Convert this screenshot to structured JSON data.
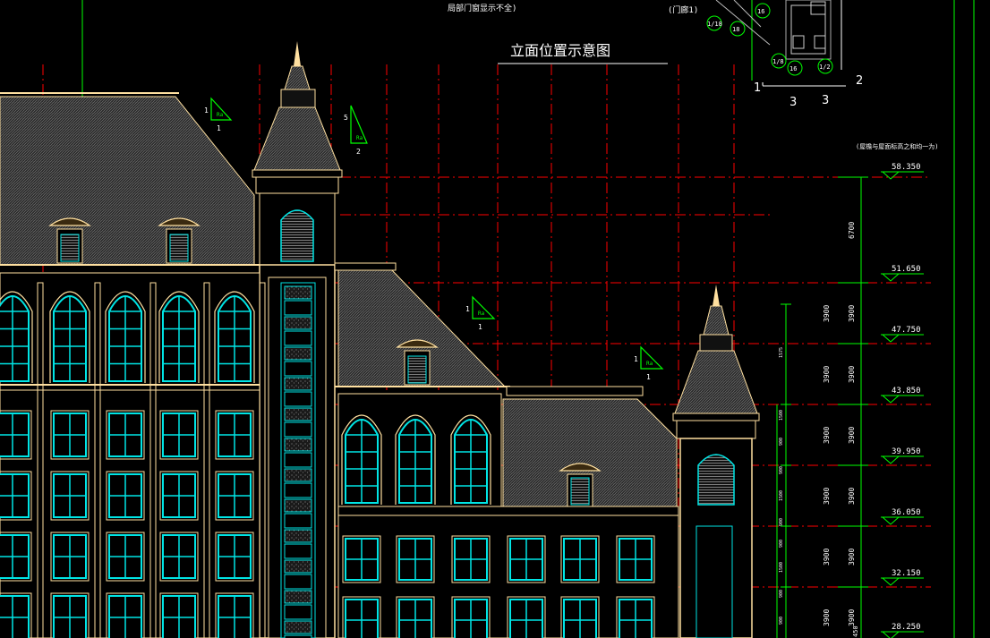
{
  "colors": {
    "background": "#000000",
    "gridline_red": "#ff0000",
    "dimension_green": "#00ff00",
    "building_outline": "#ffe0a0",
    "window_glass": "#00e5e5",
    "roof_texture": "#909090",
    "annotation_white": "#ffffff"
  },
  "header": {
    "top_note": "局部门窗显示不全)",
    "top_note_right": "(门廊1)",
    "title": "立面位置示意图"
  },
  "axis_markers": {
    "left_1": "1'",
    "right_2": "2",
    "bottom_3a": "3",
    "bottom_3b": "3",
    "bubble_a": "16",
    "bubble_b": "1/18",
    "bubble_c": "18",
    "bubble_d": "1/8",
    "bubble_e": "16",
    "bubble_f": "1/2"
  },
  "section_marks": [
    {
      "top": "1",
      "bottom": "1",
      "text": "Ra"
    },
    {
      "top": "5",
      "bottom": "2",
      "text": "Ra"
    },
    {
      "top": "1",
      "bottom": "1",
      "text": "Ra"
    },
    {
      "top": "1",
      "bottom": "1",
      "text": "Ra"
    }
  ],
  "elevation_note": "(屋檐与屋面标高之和均一为)",
  "elevations": [
    "58.350",
    "51.650",
    "47.750",
    "43.850",
    "39.950",
    "36.050",
    "32.150",
    "28.250"
  ],
  "dimensions_outer": [
    "6700",
    "3900",
    "3900",
    "3900",
    "3900",
    "3900",
    "3900"
  ],
  "dimensions_inner": [
    "3900",
    "3900",
    "3900",
    "3900",
    "3900",
    "3900"
  ],
  "dimension_bottom": "450",
  "small_dims": [
    "1575",
    "1500",
    "900",
    "900",
    "1500",
    "900",
    "900",
    "1500",
    "900",
    "900"
  ]
}
